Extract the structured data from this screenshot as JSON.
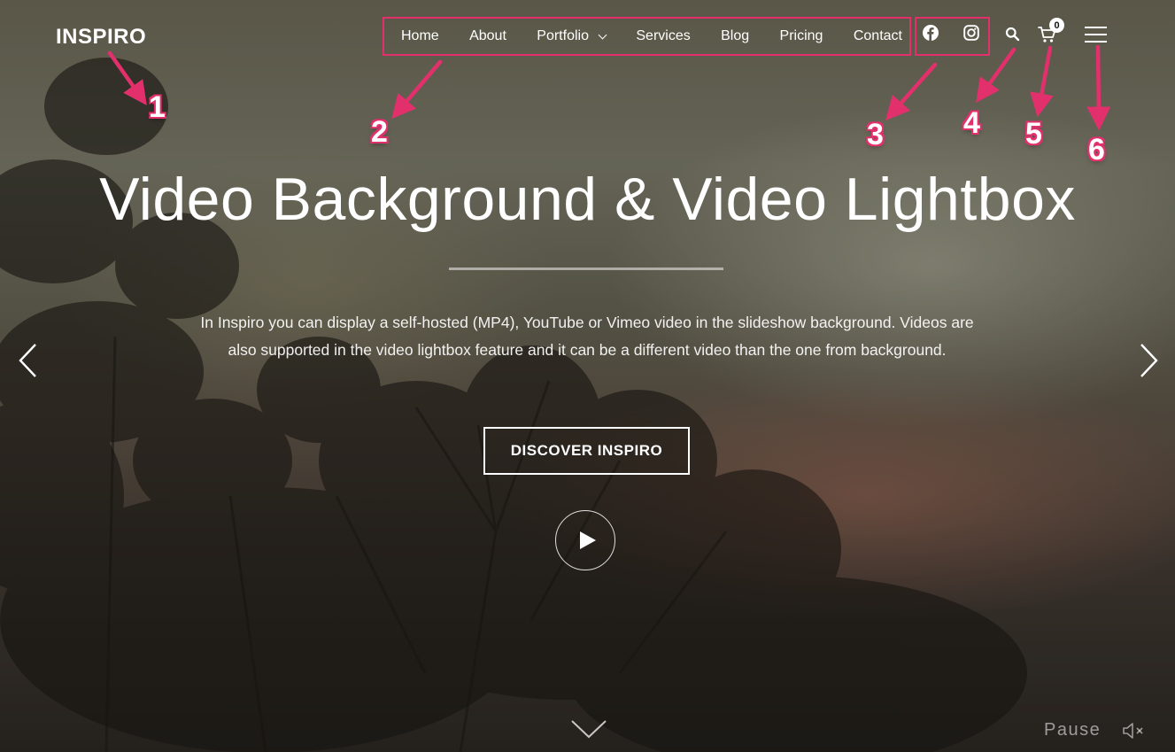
{
  "brand": {
    "logo_text": "INSPIRO"
  },
  "nav": {
    "items": [
      {
        "label": "Home"
      },
      {
        "label": "About"
      },
      {
        "label": "Portfolio",
        "has_dropdown": true
      },
      {
        "label": "Services"
      },
      {
        "label": "Blog"
      },
      {
        "label": "Pricing"
      },
      {
        "label": "Contact"
      }
    ]
  },
  "social": {
    "icons": [
      "facebook-icon",
      "instagram-icon"
    ]
  },
  "header_icons": {
    "search": "search-icon",
    "cart": "cart-icon",
    "menu": "hamburger-menu-icon"
  },
  "cart": {
    "count": "0"
  },
  "callouts": [
    "1",
    "2",
    "3",
    "4",
    "5",
    "6"
  ],
  "hero": {
    "title": "Video Background & Video Lightbox",
    "description": "In Inspiro you can display a self-hosted (MP4), YouTube or Vimeo video in the slideshow background. Videos are also supported in the video lightbox feature and it can be a different video than the one from background.",
    "cta_label": "DISCOVER INSPIRO"
  },
  "video_controls": {
    "pause_label": "Pause"
  },
  "colors": {
    "annotation": "#e2306c",
    "text": "#ffffff"
  }
}
